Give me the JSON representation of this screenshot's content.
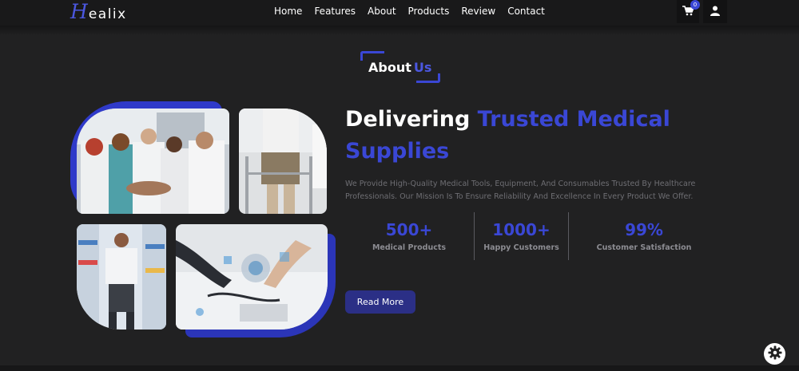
{
  "brand": {
    "logo_initial": "H",
    "logo_rest": "ealix"
  },
  "nav": {
    "items": [
      {
        "label": "Home"
      },
      {
        "label": "Features"
      },
      {
        "label": "About"
      },
      {
        "label": "Products"
      },
      {
        "label": "Review"
      },
      {
        "label": "Contact"
      }
    ],
    "cart_count": "0",
    "icons": {
      "cart": "cart-icon",
      "user": "user-icon"
    }
  },
  "section": {
    "title_first": "About",
    "title_accent": "Us"
  },
  "hero": {
    "heading_white": "Delivering",
    "heading_accent": "Trusted Medical Supplies",
    "description": "We Provide High-Quality Medical Tools, Equipment, And Consumables Trusted By Healthcare Professionals. Our Mission Is To Ensure Reliability And Excellence In Every Product We Offer.",
    "read_more_label": "Read More"
  },
  "stats": [
    {
      "value": "500+",
      "label": "Medical Products"
    },
    {
      "value": "1000+",
      "label": "Happy Customers"
    },
    {
      "value": "99%",
      "label": "Customer Satisfaction"
    }
  ],
  "colors": {
    "accent": "#3a47d5",
    "background": "#212122",
    "nav": "#19191a"
  },
  "settings_icon": "gear-icon"
}
